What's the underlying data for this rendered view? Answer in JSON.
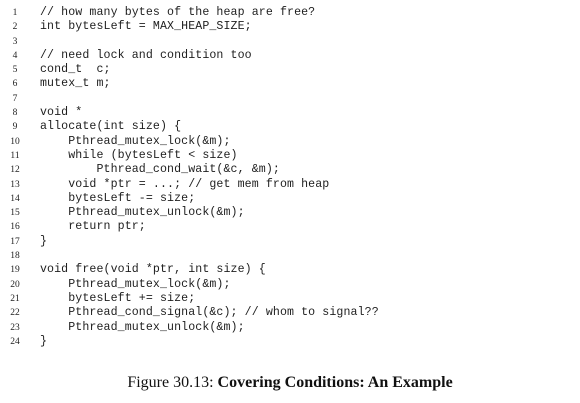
{
  "code": {
    "lines": [
      {
        "n": "1",
        "text": "// how many bytes of the heap are free?"
      },
      {
        "n": "2",
        "text": "int bytesLeft = MAX_HEAP_SIZE;"
      },
      {
        "n": "3",
        "text": ""
      },
      {
        "n": "4",
        "text": "// need lock and condition too"
      },
      {
        "n": "5",
        "text": "cond_t  c;"
      },
      {
        "n": "6",
        "text": "mutex_t m;"
      },
      {
        "n": "7",
        "text": ""
      },
      {
        "n": "8",
        "text": "void *"
      },
      {
        "n": "9",
        "text": "allocate(int size) {"
      },
      {
        "n": "10",
        "text": "    Pthread_mutex_lock(&m);"
      },
      {
        "n": "11",
        "text": "    while (bytesLeft < size)"
      },
      {
        "n": "12",
        "text": "        Pthread_cond_wait(&c, &m);"
      },
      {
        "n": "13",
        "text": "    void *ptr = ...; // get mem from heap"
      },
      {
        "n": "14",
        "text": "    bytesLeft -= size;"
      },
      {
        "n": "15",
        "text": "    Pthread_mutex_unlock(&m);"
      },
      {
        "n": "16",
        "text": "    return ptr;"
      },
      {
        "n": "17",
        "text": "}"
      },
      {
        "n": "18",
        "text": ""
      },
      {
        "n": "19",
        "text": "void free(void *ptr, int size) {"
      },
      {
        "n": "20",
        "text": "    Pthread_mutex_lock(&m);"
      },
      {
        "n": "21",
        "text": "    bytesLeft += size;"
      },
      {
        "n": "22",
        "text": "    Pthread_cond_signal(&c); // whom to signal??"
      },
      {
        "n": "23",
        "text": "    Pthread_mutex_unlock(&m);"
      },
      {
        "n": "24",
        "text": "}"
      }
    ]
  },
  "caption": {
    "label": "Figure 30.13:",
    "title": "Covering Conditions: An Example"
  }
}
